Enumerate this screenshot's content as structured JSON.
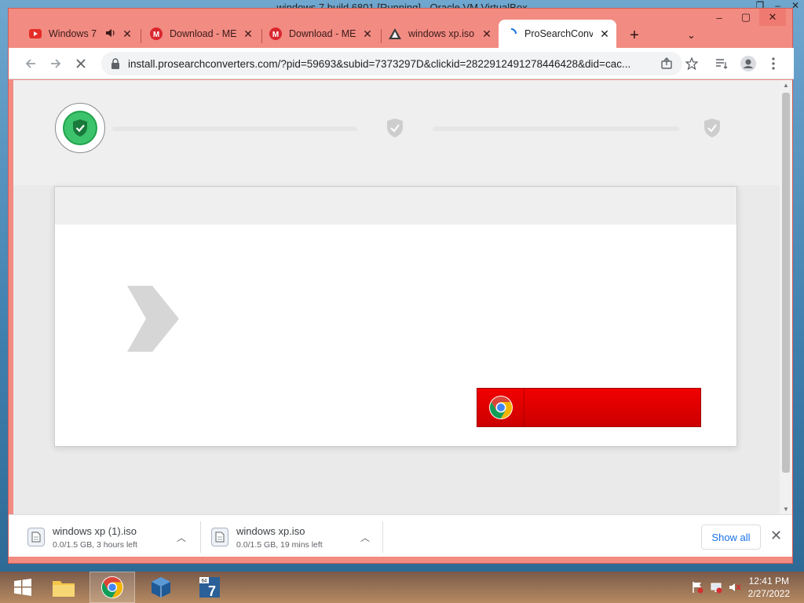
{
  "vm_window": {
    "title": "windows 7 build 6801 [Running] - Oracle VM VirtualBox",
    "controls": [
      "❐",
      "–",
      "✕"
    ]
  },
  "tabs": [
    {
      "title": "Windows 7",
      "icon": "youtube-icon",
      "extra": "speaker-icon"
    },
    {
      "title": "Download - MEG",
      "icon": "mega-icon"
    },
    {
      "title": "Download - MEG",
      "icon": "mega-icon"
    },
    {
      "title": "windows xp.iso",
      "icon": "archive-icon"
    },
    {
      "title": "ProSearchConve",
      "icon": "loading-spinner-icon",
      "active": true
    }
  ],
  "toolbar": {
    "url": "install.prosearchconverters.com/?pid=59693&subid=7373297D&clickid=2822912491278446428&did=cac..."
  },
  "page": {
    "cta_label": ""
  },
  "downloads": [
    {
      "name": "windows xp (1).iso",
      "status": "0.0/1.5 GB, 3 hours left"
    },
    {
      "name": "windows xp.iso",
      "status": "0.0/1.5 GB, 19 mins left"
    }
  ],
  "download_shelf": {
    "show_all": "Show all"
  },
  "taskbar": {
    "time": "12:41 PM",
    "date": "2/27/2022",
    "items": [
      "start-button",
      "file-explorer",
      "chrome",
      "virtualbox",
      "windows-7-app"
    ]
  },
  "colors": {
    "tabstrip": "#f28b82",
    "cta_red": "#e60000",
    "success_green": "#3cc36b"
  }
}
